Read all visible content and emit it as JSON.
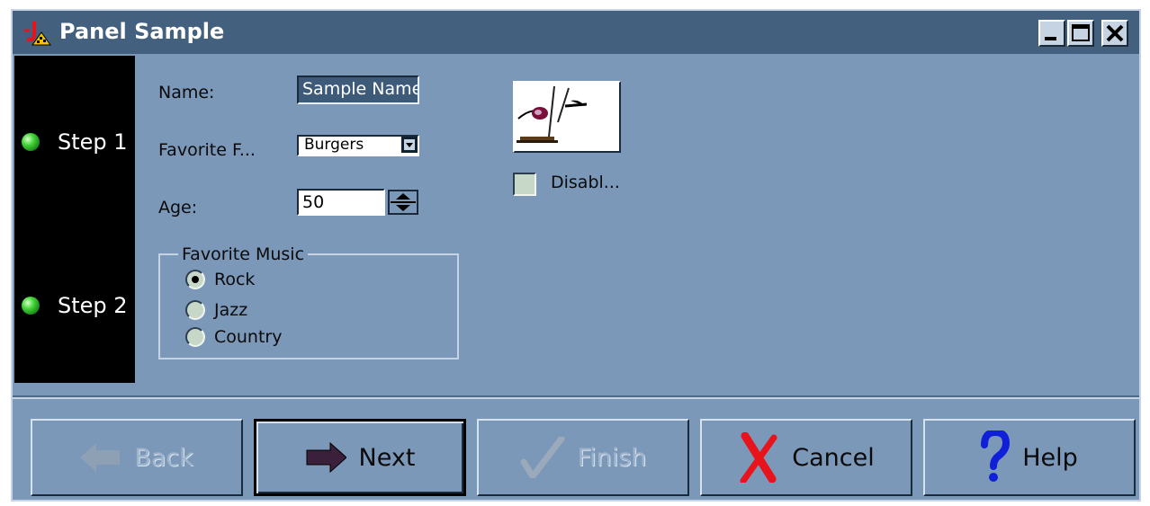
{
  "window": {
    "title": "Panel Sample",
    "controls": [
      "minimize-icon",
      "maximize-icon",
      "close-icon"
    ]
  },
  "steps": [
    {
      "label": "Step 1"
    },
    {
      "label": "Step 2"
    }
  ],
  "form": {
    "name_label": "Name:",
    "name_value": "Sample Name",
    "food_label": "Favorite F...",
    "food_value": "Burgers",
    "age_label": "Age:",
    "age_value": "50"
  },
  "music": {
    "title": "Favorite Music",
    "options": [
      {
        "label": "Rock",
        "selected": true
      },
      {
        "label": "Jazz",
        "selected": false
      },
      {
        "label": "Country",
        "selected": false
      }
    ]
  },
  "disable_checkbox": {
    "label": "Disabl...",
    "checked": false
  },
  "buttons": {
    "back": "Back",
    "next": "Next",
    "finish": "Finish",
    "cancel": "Cancel",
    "help": "Help"
  },
  "colors": {
    "window_bg": "#7b98b9",
    "titlebar": "#43617f",
    "step_led": "#2ec42e",
    "cancel_x": "#e8141c",
    "help_q": "#1020d8"
  }
}
